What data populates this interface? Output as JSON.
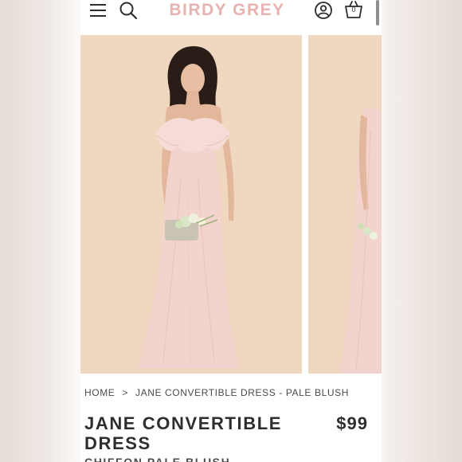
{
  "header": {
    "logo": "BIRDY GREY",
    "cart_count": "0",
    "icons": [
      "menu-icon",
      "search-icon",
      "account-icon",
      "cart-icon"
    ]
  },
  "gallery": {
    "background_color": "#f0d7c0",
    "dress_color": "#f3d3cd"
  },
  "breadcrumb": {
    "home": "HOME",
    "separator": ">",
    "current": "JANE CONVERTIBLE DRESS - PALE BLUSH"
  },
  "product": {
    "title": "JANE CONVERTIBLE DRESS",
    "price": "$99",
    "subtitle": "CHIFFON PALE BLUSH"
  },
  "colors": {
    "logo": "#e7b3b1",
    "text": "#2e2e2e"
  }
}
